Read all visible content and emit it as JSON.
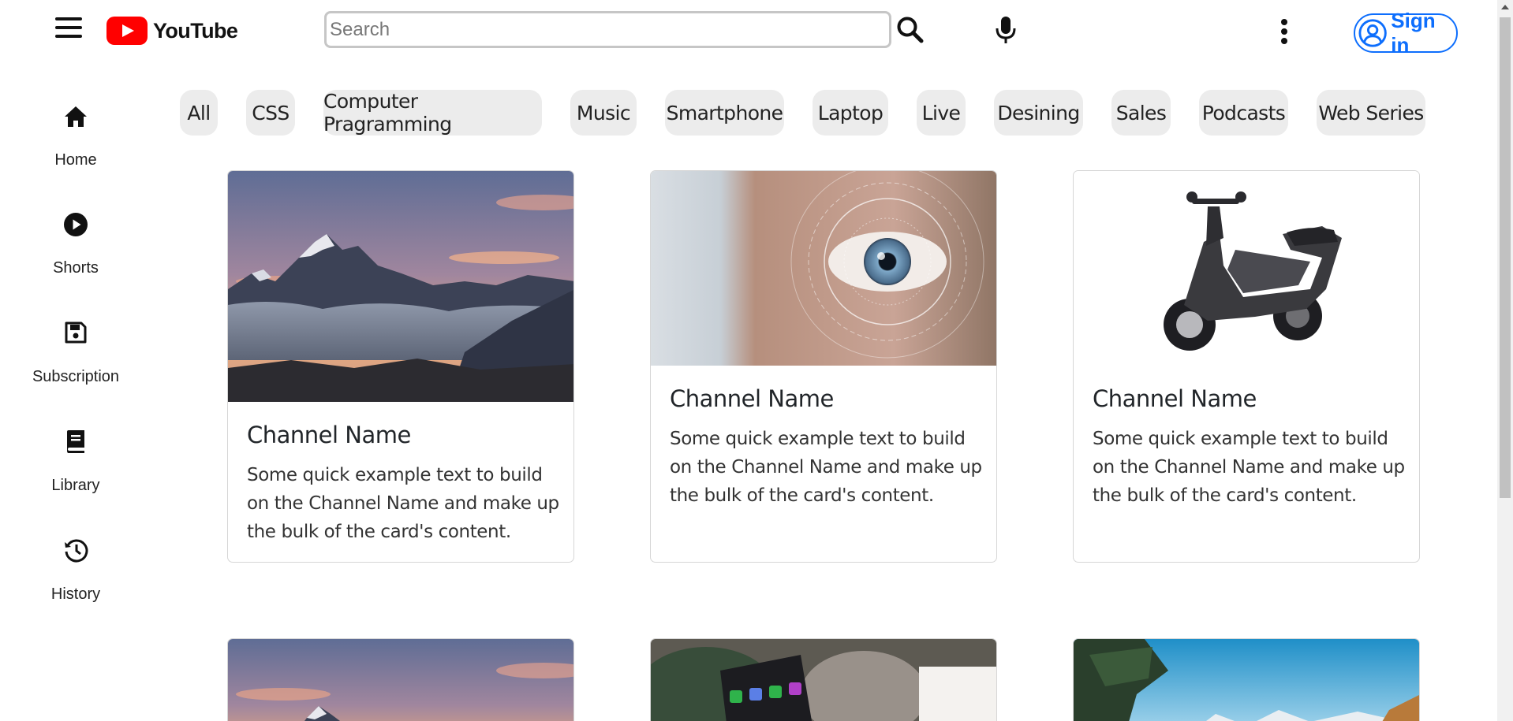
{
  "header": {
    "logo_text": "YouTube",
    "search_placeholder": "Search",
    "signin_label": "Sign in"
  },
  "icons": {
    "menu": "hamburger-menu-icon",
    "search": "magnifier-icon",
    "mic": "microphone-icon",
    "more": "vertical-dots-icon",
    "account": "user-circle-icon"
  },
  "colors": {
    "brand_red": "#ff0000",
    "signin_blue": "#0d6efd",
    "chip_bg": "#ececec"
  },
  "sidebar": {
    "items": [
      {
        "label": "Home",
        "icon": "home-icon"
      },
      {
        "label": "Shorts",
        "icon": "play-circle-icon"
      },
      {
        "label": "Subscription",
        "icon": "floppy-disk-icon"
      },
      {
        "label": "Library",
        "icon": "book-icon"
      },
      {
        "label": "History",
        "icon": "history-icon"
      }
    ]
  },
  "chips": [
    "All",
    "CSS",
    "Computer Pragramming",
    "Music",
    "Smartphone",
    "Laptop",
    "Live",
    "Desining",
    "Sales",
    "Podcasts",
    "Web Series"
  ],
  "cards": [
    {
      "title": "Channel Name",
      "text": "Some quick example text to build on the Channel Name and make up the bulk of the card's content.",
      "image": "mountain-sunset-photo"
    },
    {
      "title": "Channel Name",
      "text": "Some quick example text to build on the Channel Name and make up the bulk of the card's content.",
      "image": "eye-scan-photo"
    },
    {
      "title": "Channel Name",
      "text": "Some quick example text to build on the Channel Name and make up the bulk of the card's content.",
      "image": "scooter-photo"
    },
    {
      "image": "mountain-sunset-photo"
    },
    {
      "image": "smartphone-photo"
    },
    {
      "image": "snowy-mountain-photo"
    }
  ]
}
